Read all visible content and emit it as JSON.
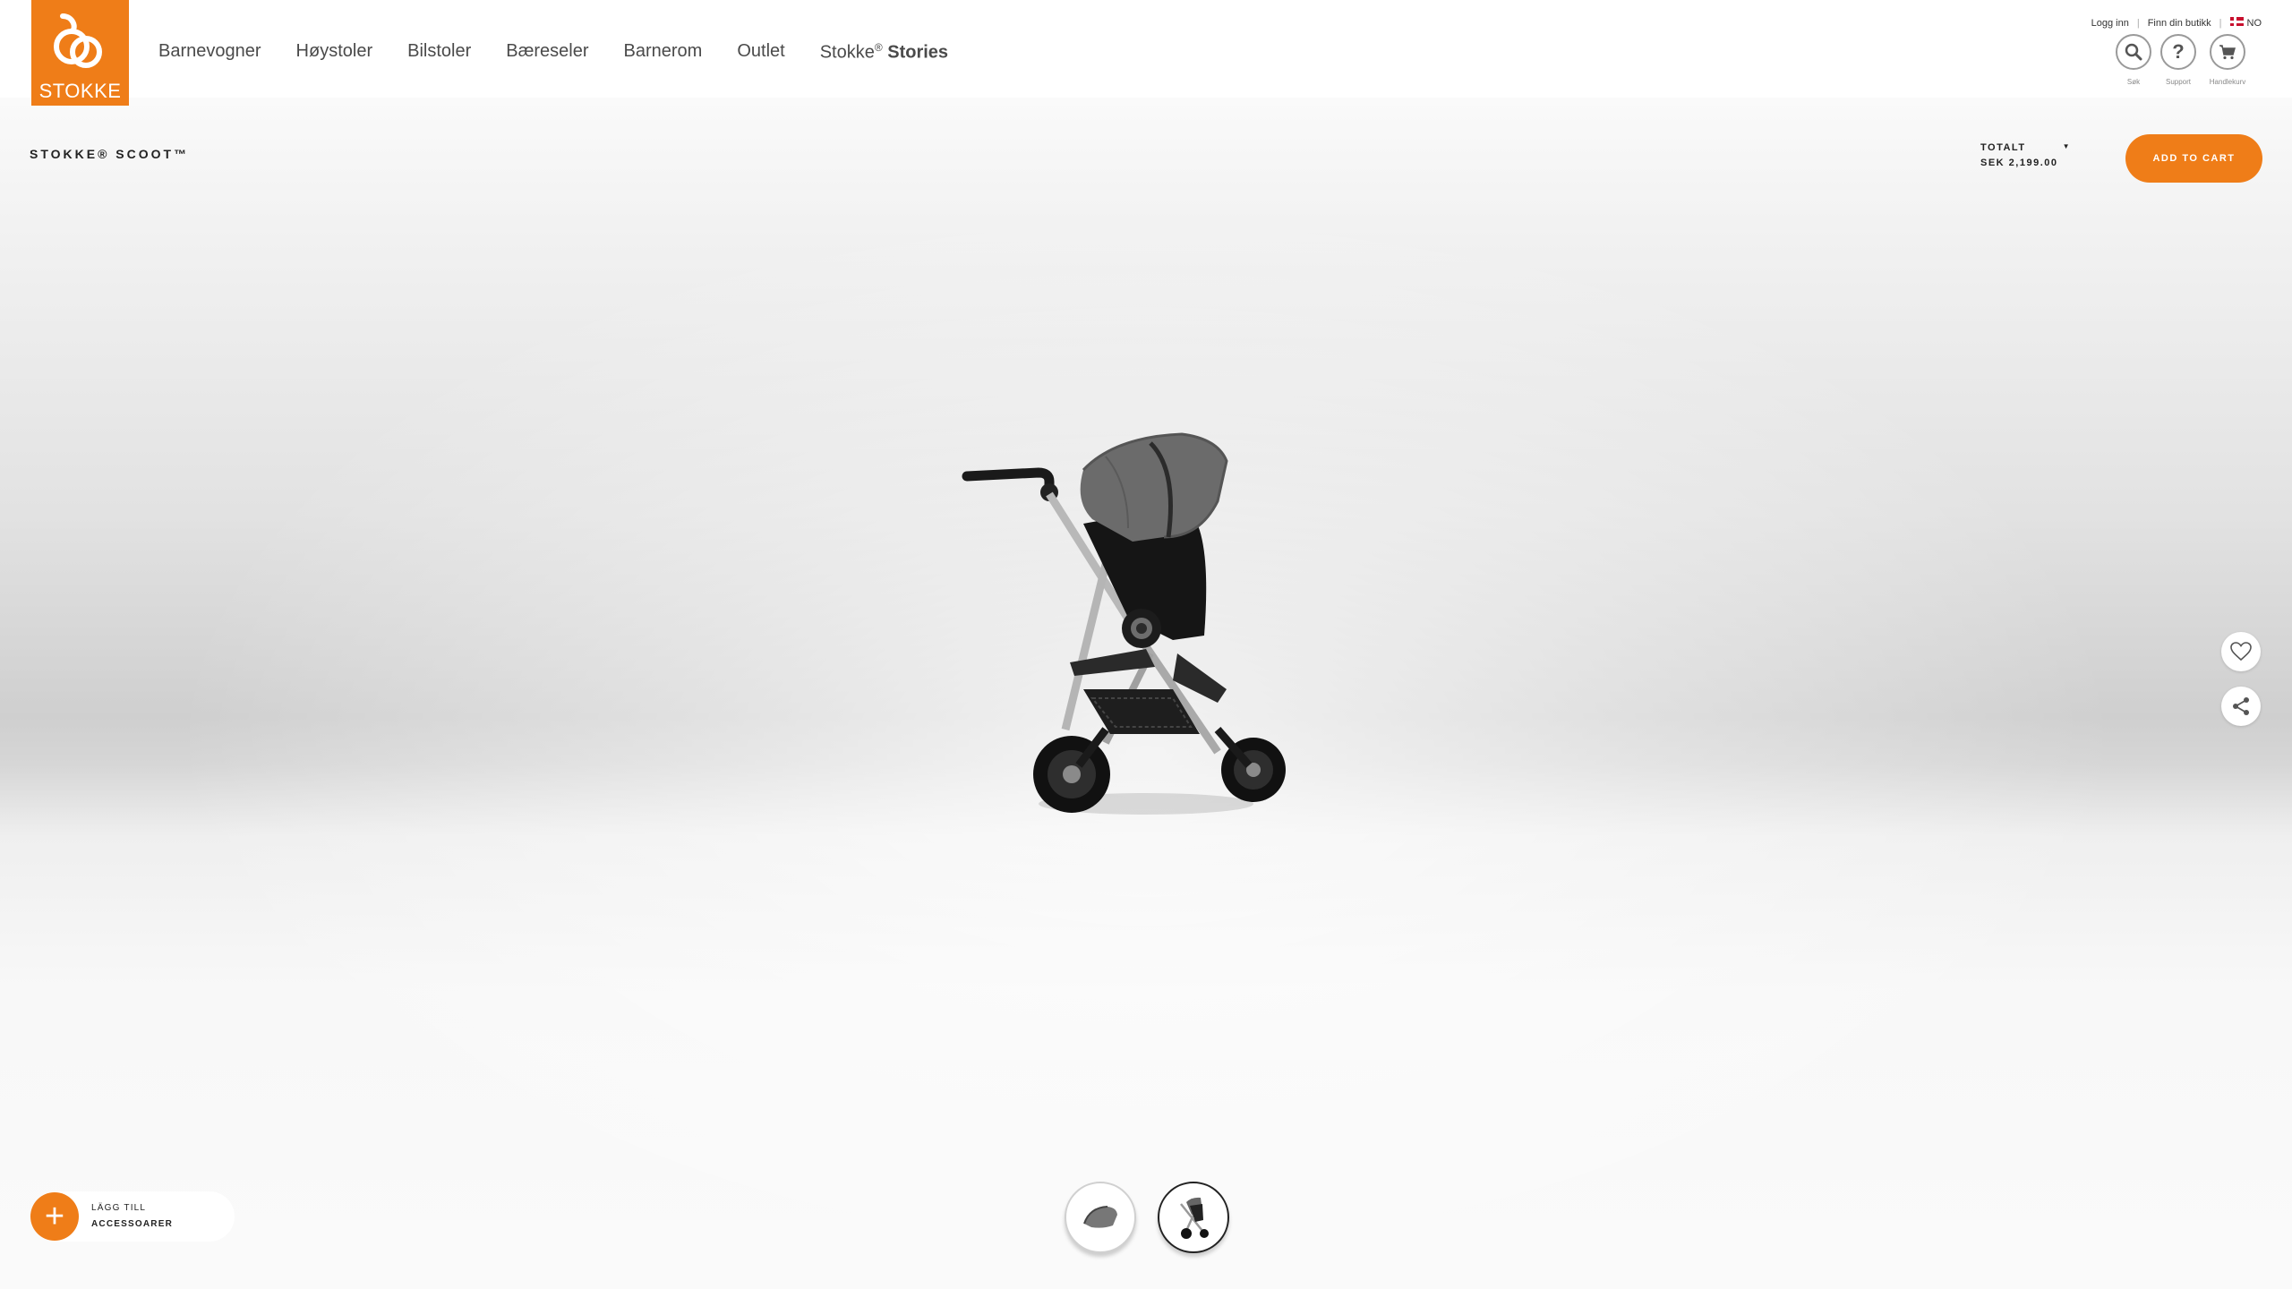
{
  "brand": {
    "logo_text": "STOKKE",
    "accent_color": "#ef7d18"
  },
  "nav": {
    "items": [
      "Barnevogner",
      "Høystoler",
      "Bilstoler",
      "Bæreseler",
      "Barnerom",
      "Outlet"
    ],
    "stories_prefix": "Stokke",
    "stories_reg": "®",
    "stories_label": "Stories"
  },
  "utility": {
    "login": "Logg inn",
    "find_store": "Finn din butikk",
    "locale": "NO",
    "search_label": "Søk",
    "support_label": "Support",
    "cart_label": "Handlekurv"
  },
  "product": {
    "title": "STOKKE® SCOOT™",
    "total_label": "TOTALT",
    "total_price": "SEK 2,199.00",
    "add_to_cart": "ADD TO CART"
  },
  "actions": {
    "favorite_icon": "heart-icon",
    "share_icon": "share-icon"
  },
  "thumbnails": [
    {
      "name": "canopy",
      "selected": false
    },
    {
      "name": "full-stroller",
      "selected": true
    }
  ],
  "accessories": {
    "line1": "LÄGG TILL",
    "line2": "ACCESSOARER"
  }
}
